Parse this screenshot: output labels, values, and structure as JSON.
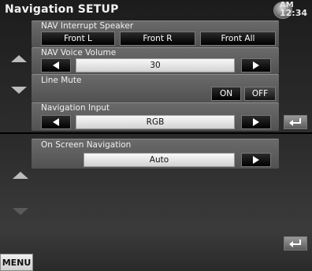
{
  "screen1": {
    "title": "Navigation SETUP",
    "clock": {
      "ampm": "AM",
      "time": "12:34"
    },
    "interrupt_speaker": {
      "label": "NAV Interrupt Speaker",
      "options": [
        "Front L",
        "Front R",
        "Front All"
      ]
    },
    "voice_volume": {
      "label": "NAV Voice Volume",
      "value": "30"
    },
    "line_mute": {
      "label": "Line Mute",
      "on": "ON",
      "off": "OFF"
    },
    "nav_input": {
      "label": "Navigation Input",
      "value": "RGB"
    }
  },
  "screen2": {
    "on_screen_nav": {
      "label": "On Screen Navigation",
      "value": "Auto"
    },
    "menu_label": "MENU"
  },
  "icons": {
    "scroll_up": "triangle-up-icon",
    "scroll_down": "triangle-down-icon",
    "return": "return-arrow-icon",
    "back": "round-back-icon"
  }
}
